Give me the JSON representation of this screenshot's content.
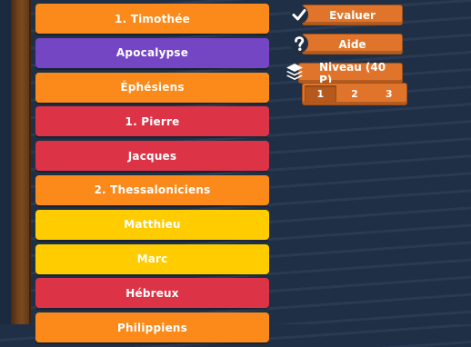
{
  "cards": [
    {
      "label": "1. Timothée",
      "color": "#fb8a1a"
    },
    {
      "label": "Apocalypse",
      "color": "#7446c4"
    },
    {
      "label": "Éphésiens",
      "color": "#fb8a1a"
    },
    {
      "label": "1. Pierre",
      "color": "#dd3346"
    },
    {
      "label": "Jacques",
      "color": "#dd3346"
    },
    {
      "label": "2. Thessaloniciens",
      "color": "#fb8a1a"
    },
    {
      "label": "Matthieu",
      "color": "#ffcc00"
    },
    {
      "label": "Marc",
      "color": "#ffcc00"
    },
    {
      "label": "Hébreux",
      "color": "#dd3346"
    },
    {
      "label": "Philippiens",
      "color": "#fb8a1a"
    }
  ],
  "controls": {
    "evaluer_label": "Evaluer",
    "aide_label": "Aide",
    "niveau_label": "Niveau (40 P)",
    "levels": [
      "1",
      "2",
      "3"
    ],
    "selected_level": "1"
  },
  "icons": {
    "evaluer": "checkmark-icon",
    "aide": "help-question-icon",
    "niveau": "layers-icon"
  },
  "colors": {
    "button_orange": "#e0742a",
    "background": "#1f2f45",
    "wood": "#6b3f19"
  }
}
